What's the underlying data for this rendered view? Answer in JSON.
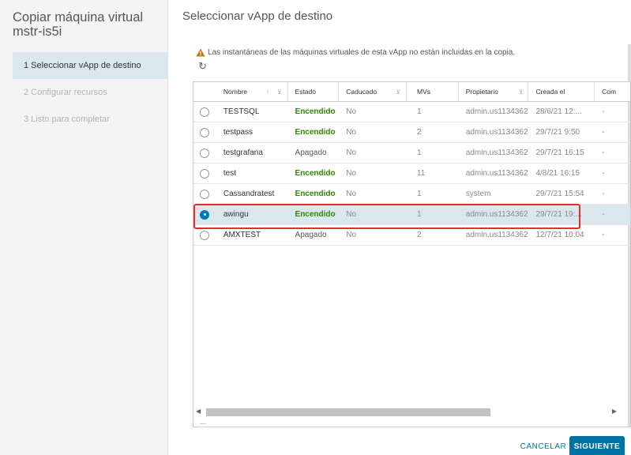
{
  "wizard": {
    "title": "Copiar máquina virtual mstr-is5i",
    "steps": [
      {
        "label": "1  Seleccionar vApp de destino"
      },
      {
        "label": "2  Configurar recursos"
      },
      {
        "label": "3  Listo para completar"
      }
    ]
  },
  "page": {
    "title": "Seleccionar vApp de destino",
    "warning": "Las instantáneas de las máquinas virtuales de esta vApp no están incluidas en la copia."
  },
  "table": {
    "columns": [
      "Nombre",
      "Estado",
      "Caducado",
      "MVs",
      "Propietario",
      "Creada el",
      "Com"
    ],
    "rows": [
      {
        "name": "TESTSQL",
        "state": "Encendido",
        "expired": "No",
        "vms": "1",
        "owner": "admin.us1134362",
        "created": "28/6/21 12:...",
        "comment": "-"
      },
      {
        "name": "testpass",
        "state": "Encendido",
        "expired": "No",
        "vms": "2",
        "owner": "admin.us1134362",
        "created": "29/7/21 9:50",
        "comment": "-"
      },
      {
        "name": "testgrafana",
        "state": "Apagado",
        "expired": "No",
        "vms": "1",
        "owner": "admin.us1134362",
        "created": "29/7/21 16:15",
        "comment": "-"
      },
      {
        "name": "test",
        "state": "Encendido",
        "expired": "No",
        "vms": "11",
        "owner": "admin.us1134362",
        "created": "4/8/21 16:15",
        "comment": "-"
      },
      {
        "name": "Cassandratest",
        "state": "Encendido",
        "expired": "No",
        "vms": "1",
        "owner": "system",
        "created": "29/7/21 15:54",
        "comment": "-"
      },
      {
        "name": "awingu",
        "state": "Encendido",
        "expired": "No",
        "vms": "1",
        "owner": "admin.us1134362",
        "created": "29/7/21 19:...",
        "comment": "-"
      },
      {
        "name": "AMXTEST",
        "state": "Apagado",
        "expired": "No",
        "vms": "2",
        "owner": "admin.us1134362",
        "created": "12/7/21 10:04",
        "comment": "-"
      }
    ],
    "selected_row": "awingu"
  },
  "footer": {
    "cancel_label": "CANCELAR",
    "next_label": "SIGUIENTE"
  },
  "icons": {
    "warning": "warning-triangle-icon",
    "refresh": "refresh-icon",
    "sort": "sort-ascending-icon",
    "filter": "filter-icon"
  },
  "colors": {
    "accent": "#0072a3",
    "powered_on": "#318700",
    "warning": "#c27b00",
    "highlight_box": "#e12e2e",
    "selected_row": "#dbe7ee"
  }
}
